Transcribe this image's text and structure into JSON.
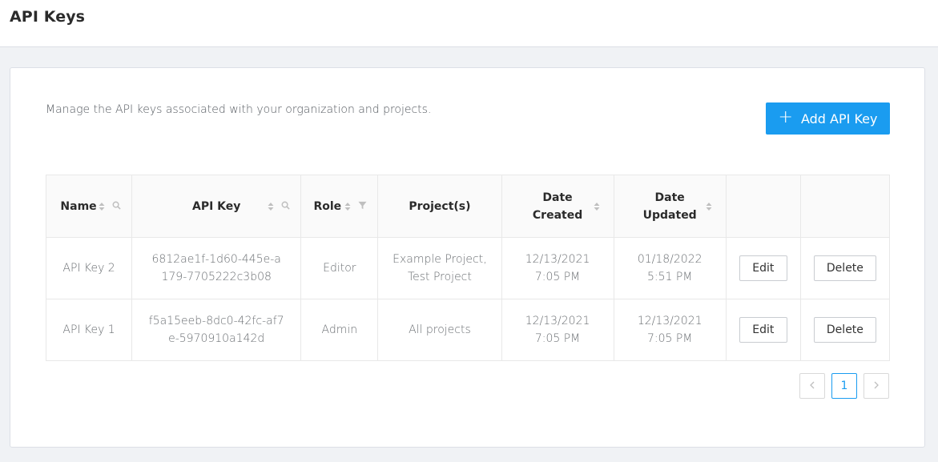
{
  "header": {
    "title": "API Keys"
  },
  "main": {
    "description": "Manage the API keys associated with your organization and projects.",
    "add_button": {
      "icon": "plus-icon",
      "label": "Add API Key",
      "color": "#1a9cf0"
    },
    "table": {
      "columns": {
        "name": "Name",
        "api_key": "API Key",
        "role": "Role",
        "projects": "Project(s)",
        "date_created": "Date Created",
        "date_updated": "Date Updated"
      },
      "rows": [
        {
          "name": "API Key 2",
          "api_key": "6812ae1f-1d60-445e-a179-7705222c3b08",
          "role": "Editor",
          "projects": "Example Project, Test Project",
          "date_created": "12/13/2021 7:05 PM",
          "date_updated": "01/18/2022 5:51 PM",
          "edit_label": "Edit",
          "delete_label": "Delete"
        },
        {
          "name": "API Key 1",
          "api_key": "f5a15eeb-8dc0-42fc-af7e-5970910a142d",
          "role": "Admin",
          "projects": "All projects",
          "date_created": "12/13/2021 7:05 PM",
          "date_updated": "12/13/2021 7:05 PM",
          "edit_label": "Edit",
          "delete_label": "Delete"
        }
      ]
    },
    "pagination": {
      "prev_icon": "chevron-left-icon",
      "current_page": "1",
      "next_icon": "chevron-right-icon",
      "active_color": "#1a9cf0"
    }
  }
}
